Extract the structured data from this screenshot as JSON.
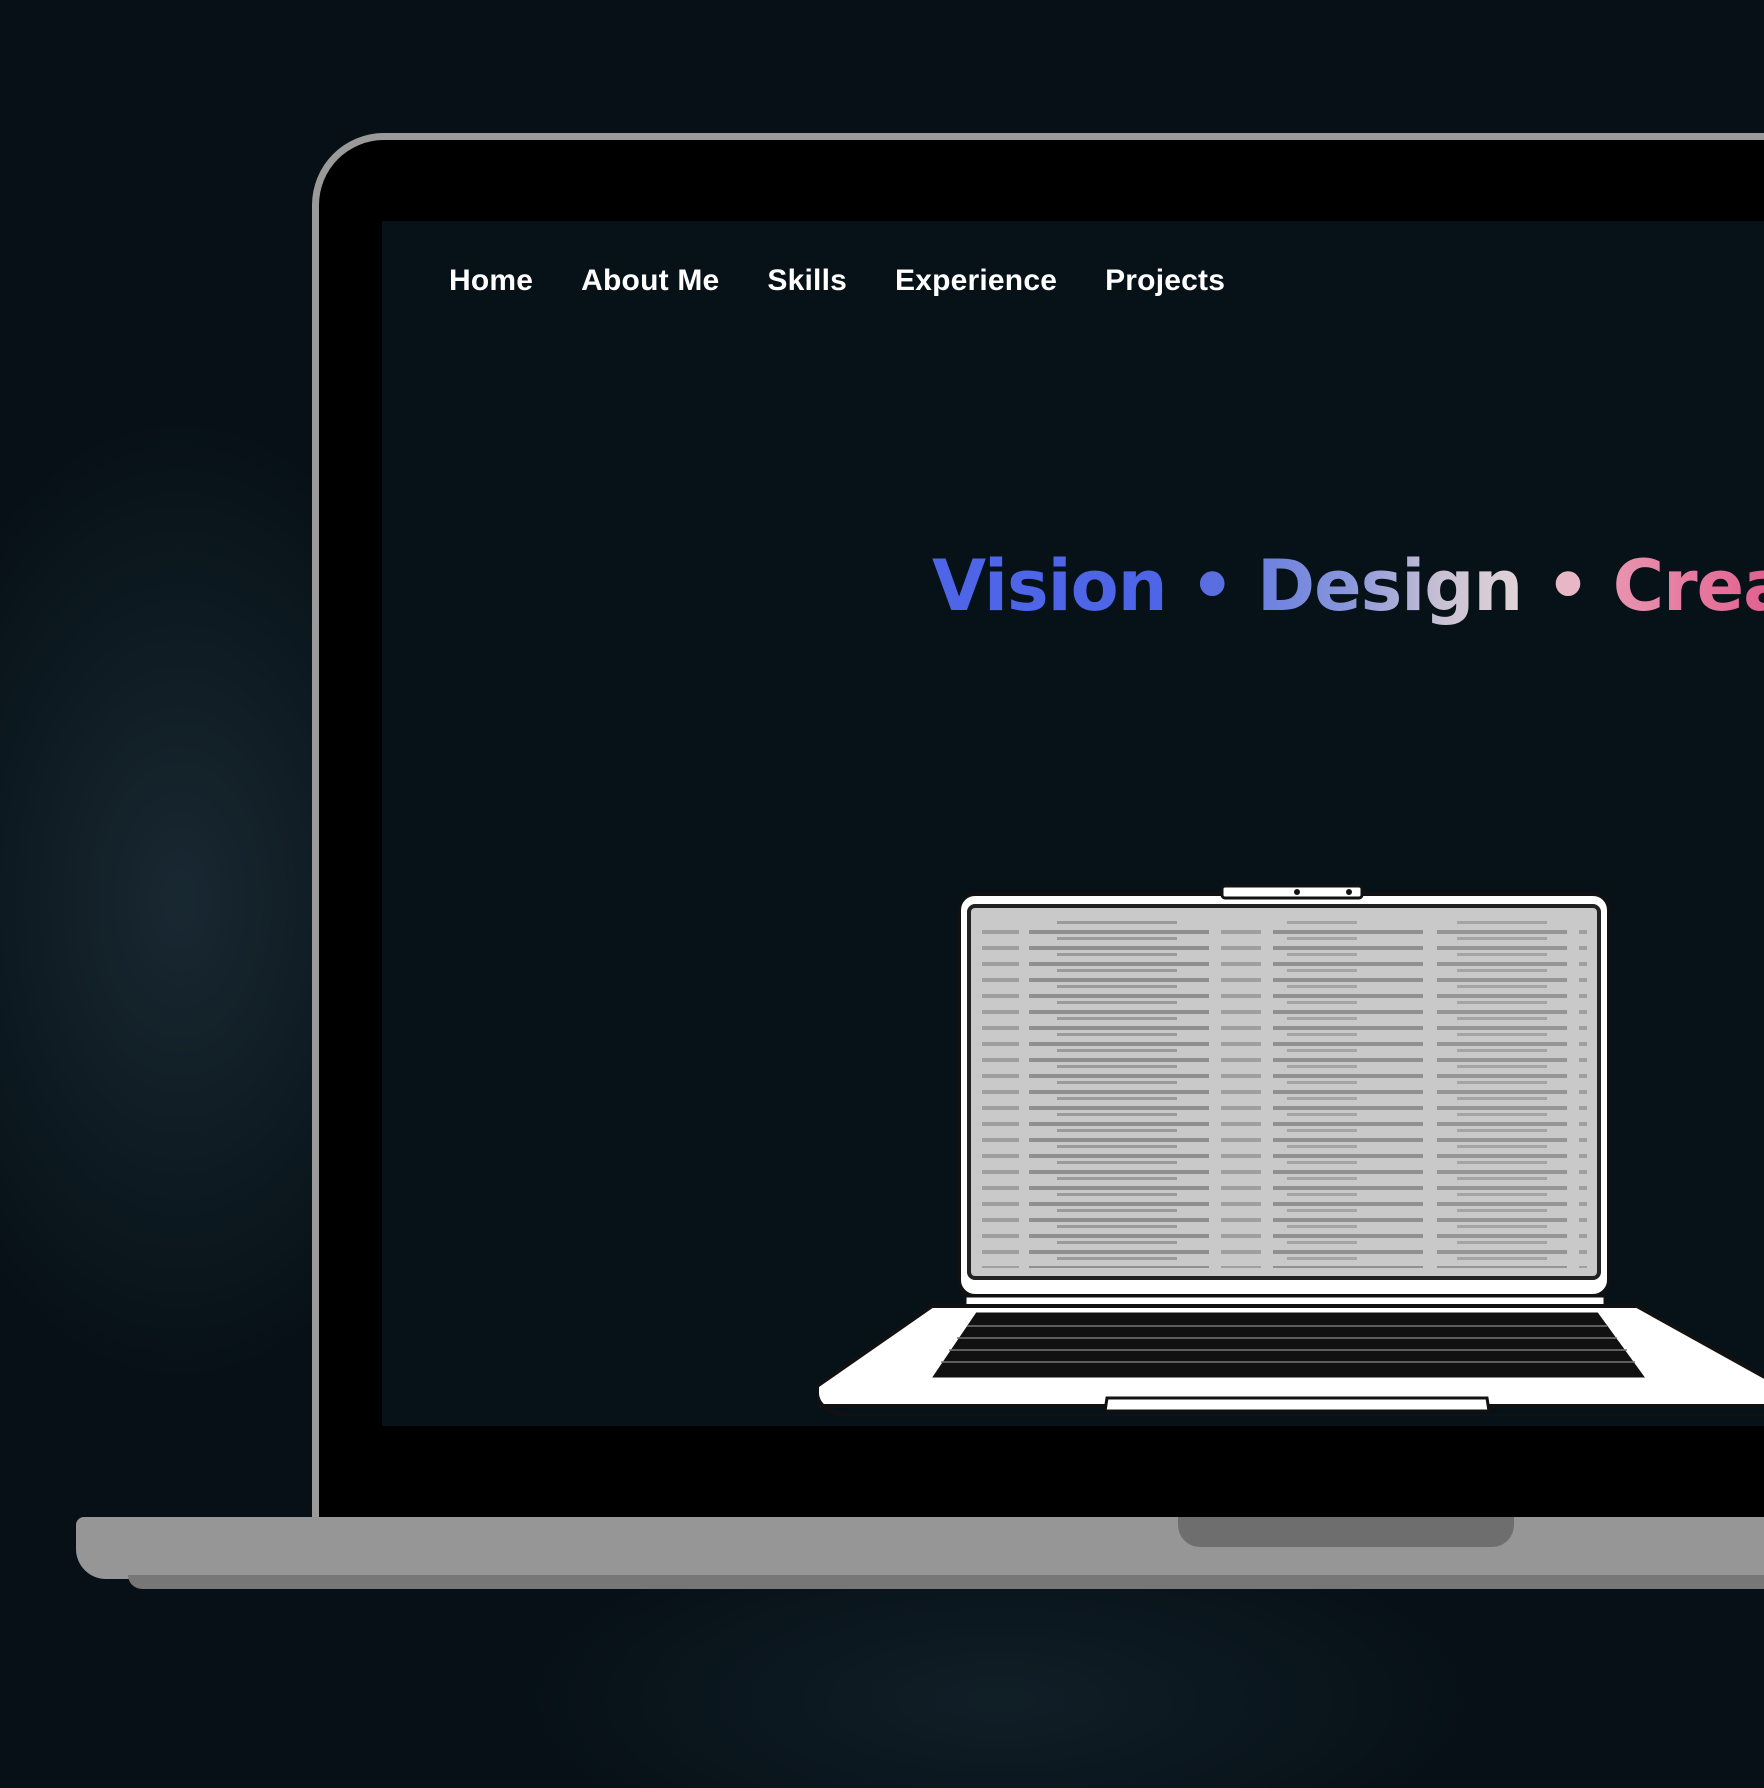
{
  "nav": {
    "items": [
      {
        "label": "Home"
      },
      {
        "label": "About Me"
      },
      {
        "label": "Skills"
      },
      {
        "label": "Experience"
      },
      {
        "label": "Projects"
      }
    ]
  },
  "hero": {
    "word1": "Vision",
    "separator": "•",
    "word2": "Design",
    "word3": "Create"
  },
  "colors": {
    "page_background": "#061016",
    "screen_background": "#071118",
    "vision_blue": "#4d65e6",
    "create_pink": "#e36a95",
    "device_frame": "#969696"
  },
  "illustration": {
    "icon": "laptop-illustration"
  }
}
